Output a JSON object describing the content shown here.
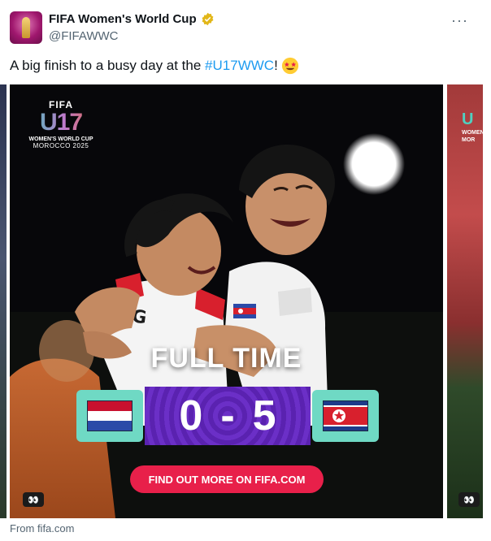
{
  "tweet": {
    "display_name": "FIFA Women's World Cup",
    "handle": "@FIFAWWC",
    "more_label": "···",
    "text_prefix": "A big finish to a busy day at the ",
    "hashtag": "#U17WWC",
    "text_suffix": "!"
  },
  "media": {
    "logo_fifa": "FIFA",
    "logo_u17": "U17",
    "logo_line1": "WOMEN'S WORLD CUP",
    "logo_line2": "MOROCCO 2025",
    "jersey_text": "NG",
    "headline": "FULL TIME",
    "home_score": "0",
    "separator": "-",
    "away_score": "5",
    "cta": "FIND OUT MORE ON FIFA.COM",
    "eyes_label": "👀",
    "next_logo_u": "U",
    "next_logo_text": "WOMEN MOR"
  },
  "source": "From fifa.com",
  "icons": [
    "verified-badge-icon",
    "star-struck-emoji-icon",
    "eyes-icon",
    "netherlands-flag-icon",
    "north-korea-flag-icon"
  ],
  "colors": {
    "hashtag": "#1d9bf0",
    "cta": "#e8204a",
    "score_bg": "#6b2fc7",
    "flag_box": "#6fd9c4",
    "verified": "#e2b719"
  }
}
